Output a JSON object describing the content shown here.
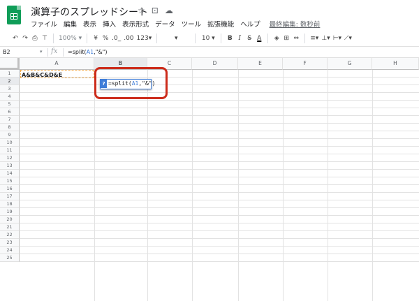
{
  "document": {
    "title": "演算子のスプレッドシート",
    "title_icons": [
      "star-icon",
      "move-to-folder-icon",
      "cloud-status-icon"
    ]
  },
  "menu": {
    "items": [
      "ファイル",
      "編集",
      "表示",
      "挿入",
      "表示形式",
      "データ",
      "ツール",
      "拡張機能",
      "ヘルプ"
    ],
    "last_edit": "最終編集: 数秒前"
  },
  "toolbar": {
    "zoom": "100%",
    "currency": "¥",
    "percent": "%",
    "decrease_decimal": ".0_",
    "increase_decimal": ".00",
    "more_formats": "123",
    "font_size": "10",
    "bold": "B",
    "italic": "I",
    "strikethrough": "S",
    "text_color": "A"
  },
  "formula_bar": {
    "name_box": "B2",
    "fx": "fx",
    "formula_prefix": "=split(",
    "formula_ref": "A1",
    "formula_suffix": ",\"&\")"
  },
  "sheet": {
    "columns": [
      "A",
      "B",
      "C",
      "D",
      "E",
      "F",
      "G",
      "H"
    ],
    "active_column": "B",
    "rows": [
      "1",
      "2",
      "3",
      "4",
      "5",
      "6",
      "7",
      "8",
      "9",
      "10",
      "11",
      "12",
      "13",
      "14",
      "15",
      "16",
      "17",
      "18",
      "19",
      "20",
      "21",
      "22",
      "23",
      "24",
      "25"
    ],
    "active_row": "2",
    "cells": {
      "A1": "A&B&C&D&E"
    }
  },
  "editor": {
    "help": "?",
    "formula_prefix": "=split(",
    "formula_ref": "A1",
    "formula_suffix": ",\"&\")"
  },
  "colors": {
    "brand_green": "#0f9d58",
    "reference_blue": "#3f7dd8",
    "highlight_red": "#cc2c1b"
  }
}
